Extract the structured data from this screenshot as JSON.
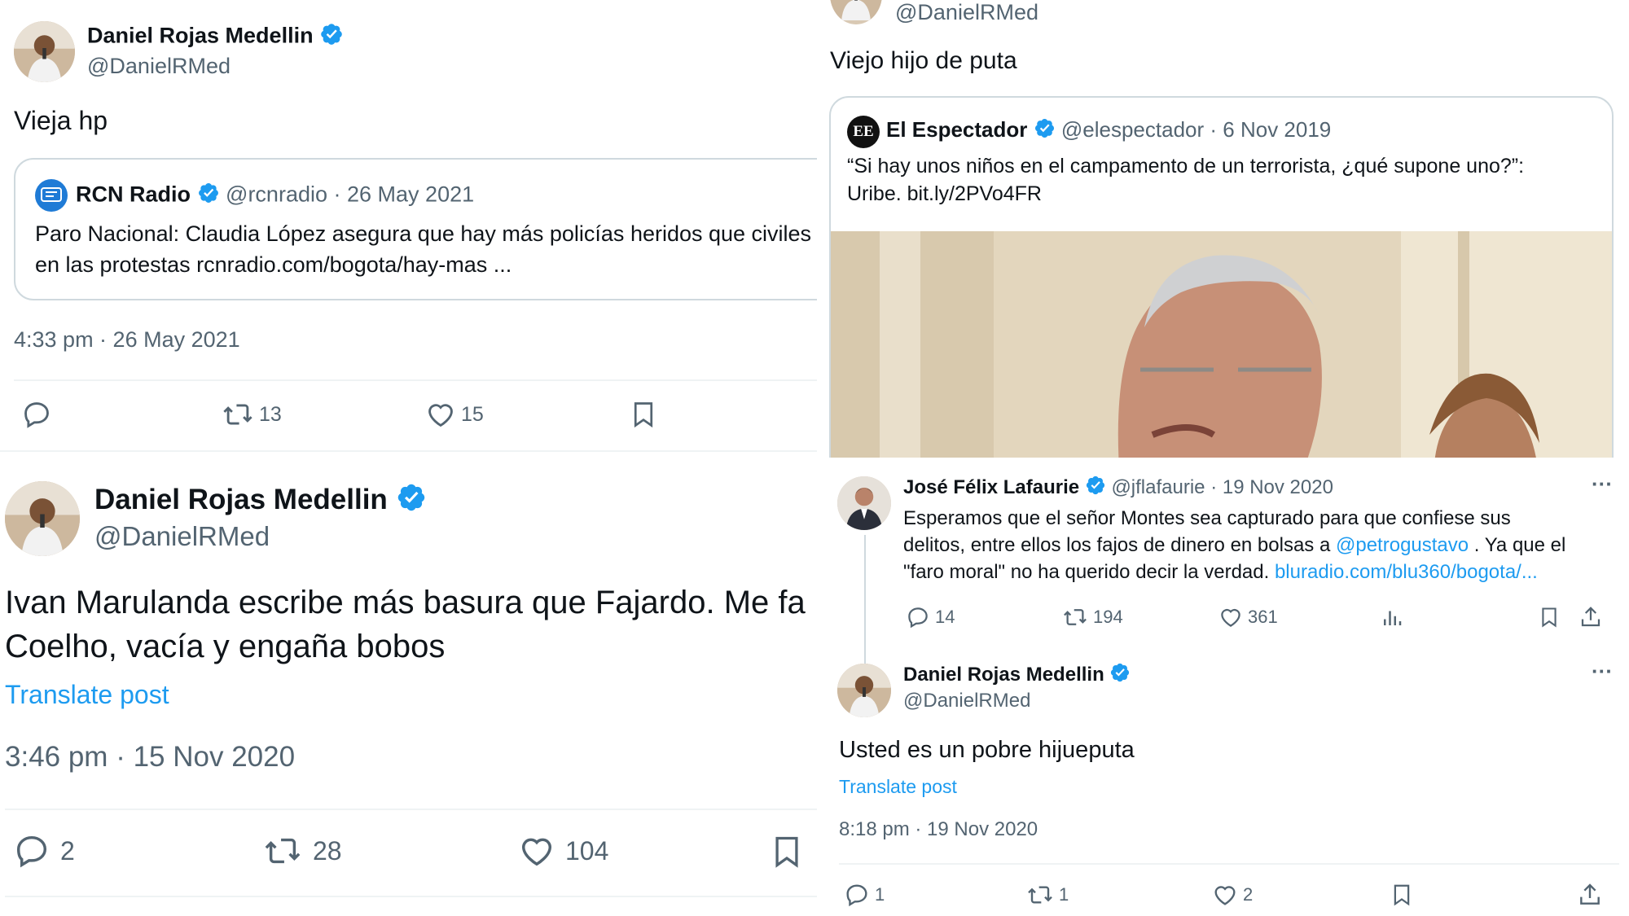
{
  "tweet1": {
    "author_name": "Daniel Rojas Medellin",
    "author_handle": "@DanielRMed",
    "text": "Vieja hp",
    "quote": {
      "name": "RCN Radio",
      "handle": "@rcnradio",
      "date": "· 26 May 2021",
      "line1": "Paro Nacional: Claudia López asegura que hay más policías heridos que civiles",
      "line2": "en las protestas rcnradio.com/bogota/hay-mas ..."
    },
    "timestamp": "4:33 pm · 26 May 2021",
    "retweets": "13",
    "likes": "15"
  },
  "tweet2": {
    "author_name": "Daniel Rojas Medellin",
    "author_handle": "@DanielRMed",
    "line1": "Ivan Marulanda escribe más basura que Fajardo. Me fa",
    "line2": "Coelho, vacía y engaña bobos",
    "translate": "Translate post",
    "timestamp": "3:46 pm · 15 Nov 2020",
    "replies": "2",
    "retweets": "28",
    "likes": "104"
  },
  "tweet3": {
    "author_handle": "@DanielRMed",
    "text": "Viejo hijo de puta",
    "quote": {
      "logo": "EE",
      "name": "El Espectador",
      "handle": "@elespectador",
      "date": "· 6 Nov 2019",
      "line1": "“Si hay unos niños en el campamento de un terrorista, ¿qué supone uno?”:",
      "line2": "Uribe. bit.ly/2PVo4FR"
    }
  },
  "tweet4": {
    "parent": {
      "name": "José Félix Lafaurie",
      "handle": "@jflafaurie",
      "date": "· 19 Nov 2020",
      "more": "···",
      "line1": "Esperamos que el señor Montes sea capturado para que confiese sus",
      "line2a": "delitos, entre ellos los fajos de dinero en bolsas a ",
      "mention": "@petrogustavo",
      "line2b": " . Ya que el",
      "line3a": "\"faro moral\" no ha querido decir la verdad. ",
      "link": "bluradio.com/blu360/bogota/...",
      "replies": "14",
      "retweets": "194",
      "likes": "361"
    },
    "reply": {
      "name": "Daniel Rojas Medellin",
      "handle": "@DanielRMed",
      "more": "···",
      "text": "Usted es un pobre hijueputa",
      "translate": "Translate post",
      "timestamp": "8:18 pm · 19 Nov 2020",
      "replies": "1",
      "retweets": "1",
      "likes": "2"
    }
  },
  "colors": {
    "accent": "#1d9bf0",
    "text": "#0f1419",
    "secondary": "#536471",
    "verified": "#1d9bf0",
    "border": "#cfd9de"
  }
}
